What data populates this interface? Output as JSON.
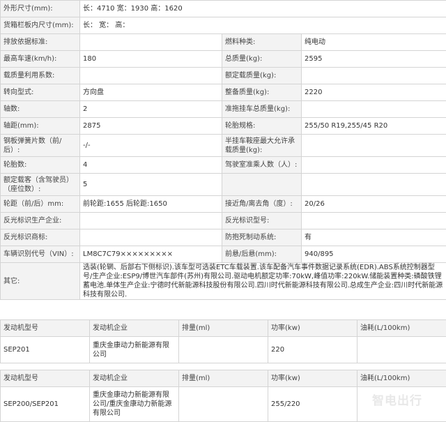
{
  "spec_rows": [
    {
      "type": "full",
      "label": "外形尺寸(mm):",
      "value": "长：4710 宽：1930 高：1620"
    },
    {
      "type": "full",
      "label": "货箱栏板内尺寸(mm):",
      "value": "长： 宽： 高："
    },
    {
      "type": "pair",
      "l1": "排放依据标准:",
      "v1": "",
      "l2": "燃料种类:",
      "v2": "纯电动"
    },
    {
      "type": "pair",
      "l1": "最高车速(km/h):",
      "v1": "180",
      "l2": "总质量(kg):",
      "v2": "2595"
    },
    {
      "type": "pair",
      "l1": "载质量利用系数:",
      "v1": "",
      "l2": "额定载质量(kg):",
      "v2": ""
    },
    {
      "type": "pair",
      "l1": "转向型式:",
      "v1": "方向盘",
      "l2": "整备质量(kg):",
      "v2": "2220"
    },
    {
      "type": "pair",
      "l1": "轴数:",
      "v1": "2",
      "l2": "准拖挂车总质量(kg):",
      "v2": ""
    },
    {
      "type": "pair",
      "l1": "轴距(mm):",
      "v1": "2875",
      "l2": "轮胎规格:",
      "v2": "255/50 R19,255/45 R20"
    },
    {
      "type": "pair",
      "l1": "钢板弹簧片数（前/后）:",
      "v1": "-/-",
      "l2": "半挂车鞍座最大允许承载质量(kg):",
      "v2": ""
    },
    {
      "type": "pair",
      "l1": "轮胎数:",
      "v1": "4",
      "l2": "驾驶室准乘人数（人）:",
      "v2": ""
    },
    {
      "type": "pair",
      "l1": "额定载客（含驾驶员）（座位数）:",
      "v1": "5",
      "l2": "",
      "v2": ""
    },
    {
      "type": "pair",
      "l1": "轮距（前/后）mm:",
      "v1": "前轮距:1655 后轮距:1650",
      "l2": "接近角/离去角（度）:",
      "v2": "20/26"
    },
    {
      "type": "pair",
      "l1": "反光标识生产企业:",
      "v1": "",
      "l2": "反光标识型号:",
      "v2": ""
    },
    {
      "type": "pair",
      "l1": "反光标识商标:",
      "v1": "",
      "l2": "防抱死制动系统:",
      "v2": "有"
    },
    {
      "type": "pair",
      "l1": "车辆识别代号（VIN）:",
      "v1": "LM8C7C79×××××××××",
      "l2": "前悬/后悬(mm):",
      "v2": "940/895"
    },
    {
      "type": "full",
      "label": "其它:",
      "value": "选装(轮辋、后部右下侧标识).该车型可选装ETC车载装置.该车配备汽车事件数据记录系统(EDR).ABS系统控制器型号/生产企业:ESP9/博世汽车部件(苏州)有限公司.驱动电机额定功率:70kW,峰值功率:220kW.储能装置种类:磷酸铁锂蓄电池.单体生产企业:宁德时代新能源科技股份有限公司.四川时代新能源科技有限公司.总成生产企业:四川时代新能源科技有限公司."
    }
  ],
  "engine_tables": [
    {
      "headers": [
        "发动机型号",
        "发动机企业",
        "排量(ml)",
        "功率(kw)",
        "油耗(L/100km)"
      ],
      "rows": [
        [
          "SEP201",
          "重庆金康动力新能源有限公司",
          "",
          "220",
          ""
        ]
      ]
    },
    {
      "headers": [
        "发动机型号",
        "发动机企业",
        "排量(ml)",
        "功率(kw)",
        "油耗(L/100km)"
      ],
      "rows": [
        [
          "SEP200/SEP201",
          "重庆金康动力新能源有限公司/重庆金康动力新能源有限公司",
          "",
          "255/220",
          ""
        ]
      ]
    }
  ],
  "watermark": "智电出行"
}
